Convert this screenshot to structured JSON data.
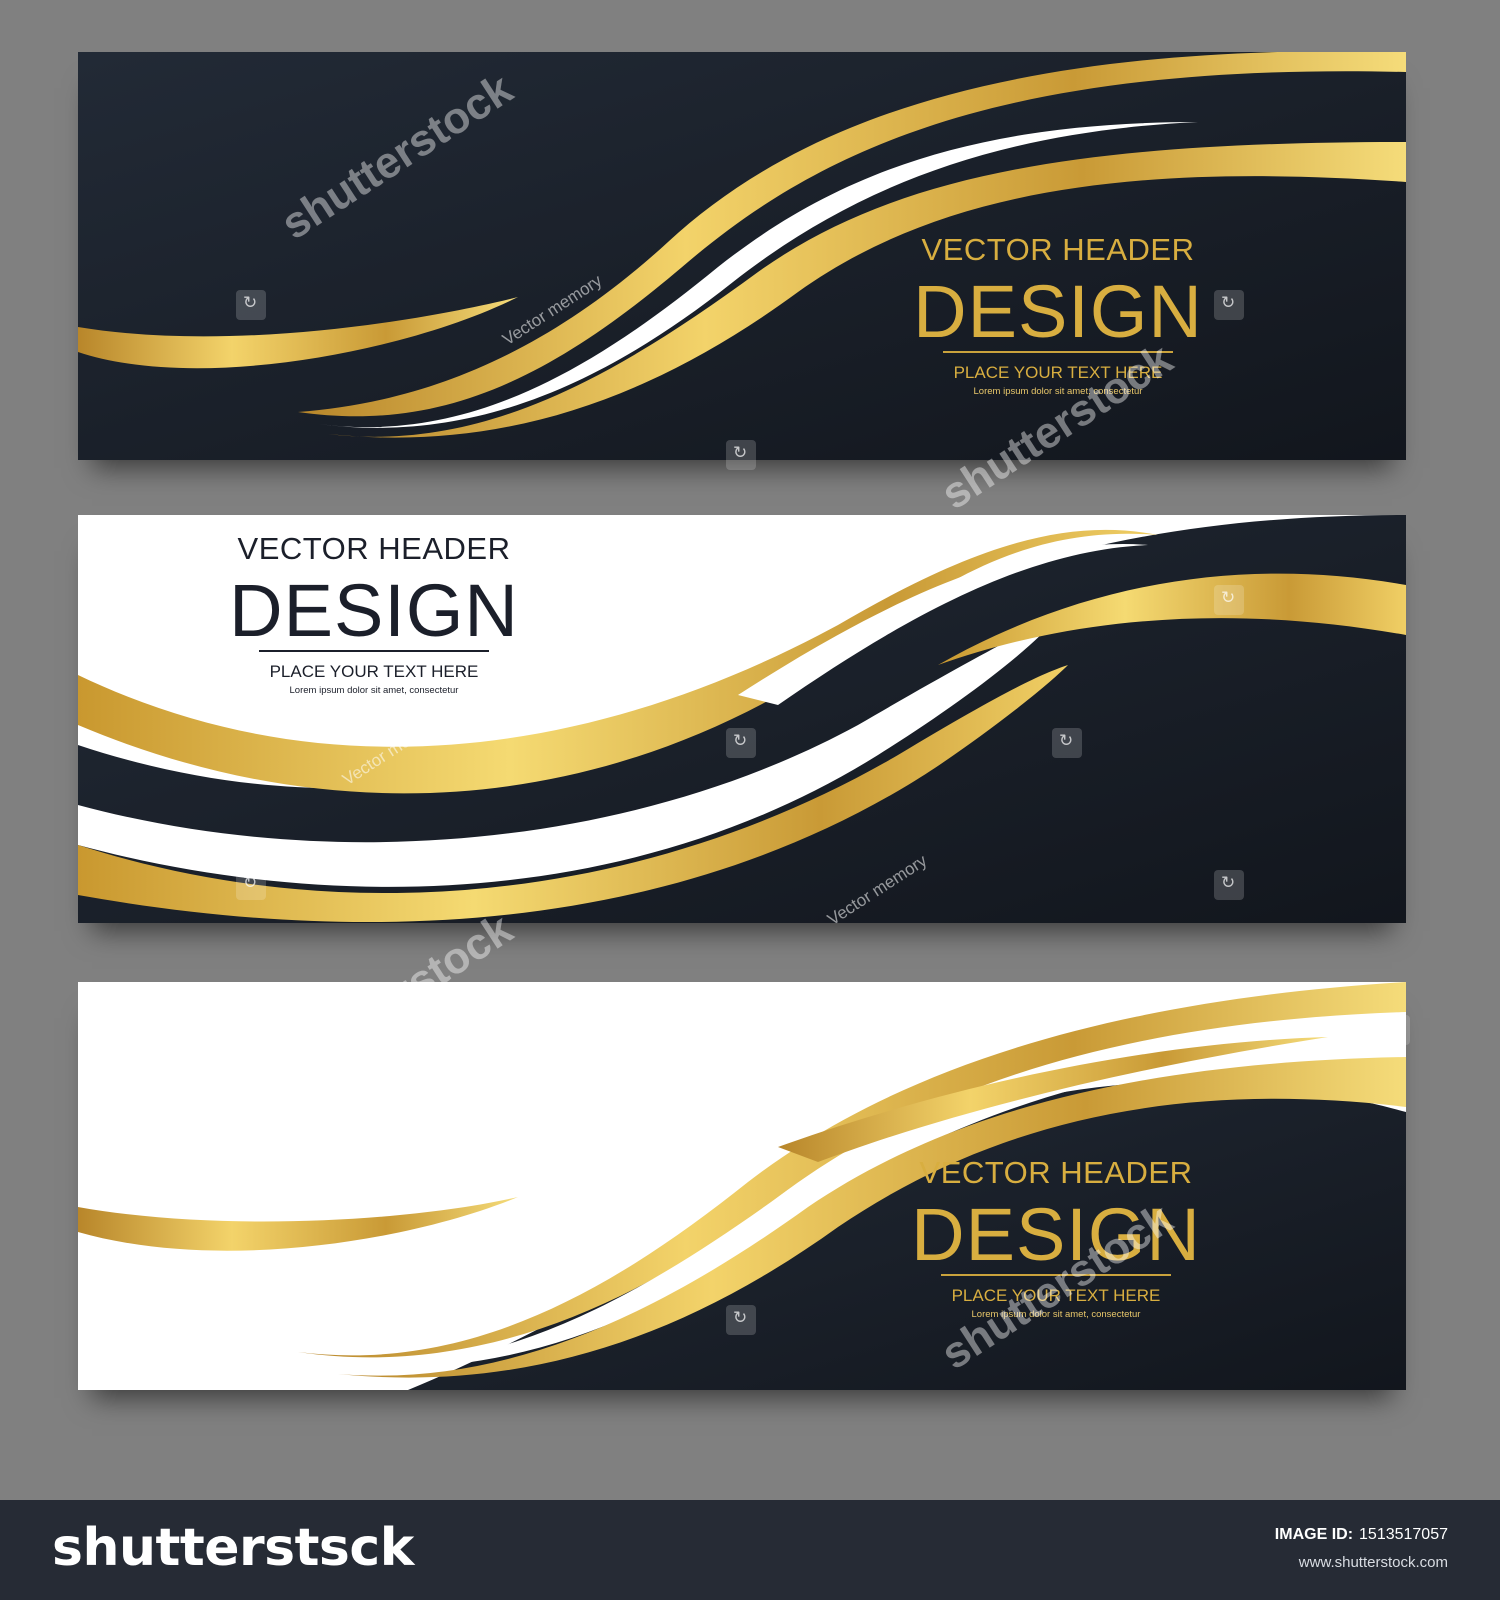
{
  "banners": [
    {
      "id": "banner-1",
      "header_line": "VECTOR HEADER",
      "title": "DESIGN",
      "subtitle": "PLACE YOUR TEXT HERE",
      "body": "Lorem ipsum dolor sit amet, consectetur",
      "text_color": "#d8ae40",
      "background": "#1c222c"
    },
    {
      "id": "banner-2",
      "header_line": "VECTOR HEADER",
      "title": "DESIGN",
      "subtitle": "PLACE YOUR TEXT HERE",
      "body": "Lorem ipsum dolor sit amet, consectetur",
      "text_color": "#1b1f2a",
      "background": "#ffffff"
    },
    {
      "id": "banner-3",
      "header_line": "VECTOR HEADER",
      "title": "DESIGN",
      "subtitle": "PLACE YOUR TEXT HERE",
      "body": "Lorem ipsum dolor sit amet, consectetur",
      "text_color": "#d8ae40",
      "background": "#ffffff"
    }
  ],
  "watermark": {
    "brand": "shutterstock",
    "credit": "Vector memory"
  },
  "footer": {
    "logo": "shutterstsck",
    "image_id_label": "IMAGE ID:",
    "image_id": "1513517057",
    "url": "www.shutterstock.com"
  },
  "colors": {
    "page_bg": "#808080",
    "navy": "#1c222c",
    "gold_light": "#f5d56a",
    "gold_dark": "#b8862a",
    "footer_bg": "#262b35"
  }
}
